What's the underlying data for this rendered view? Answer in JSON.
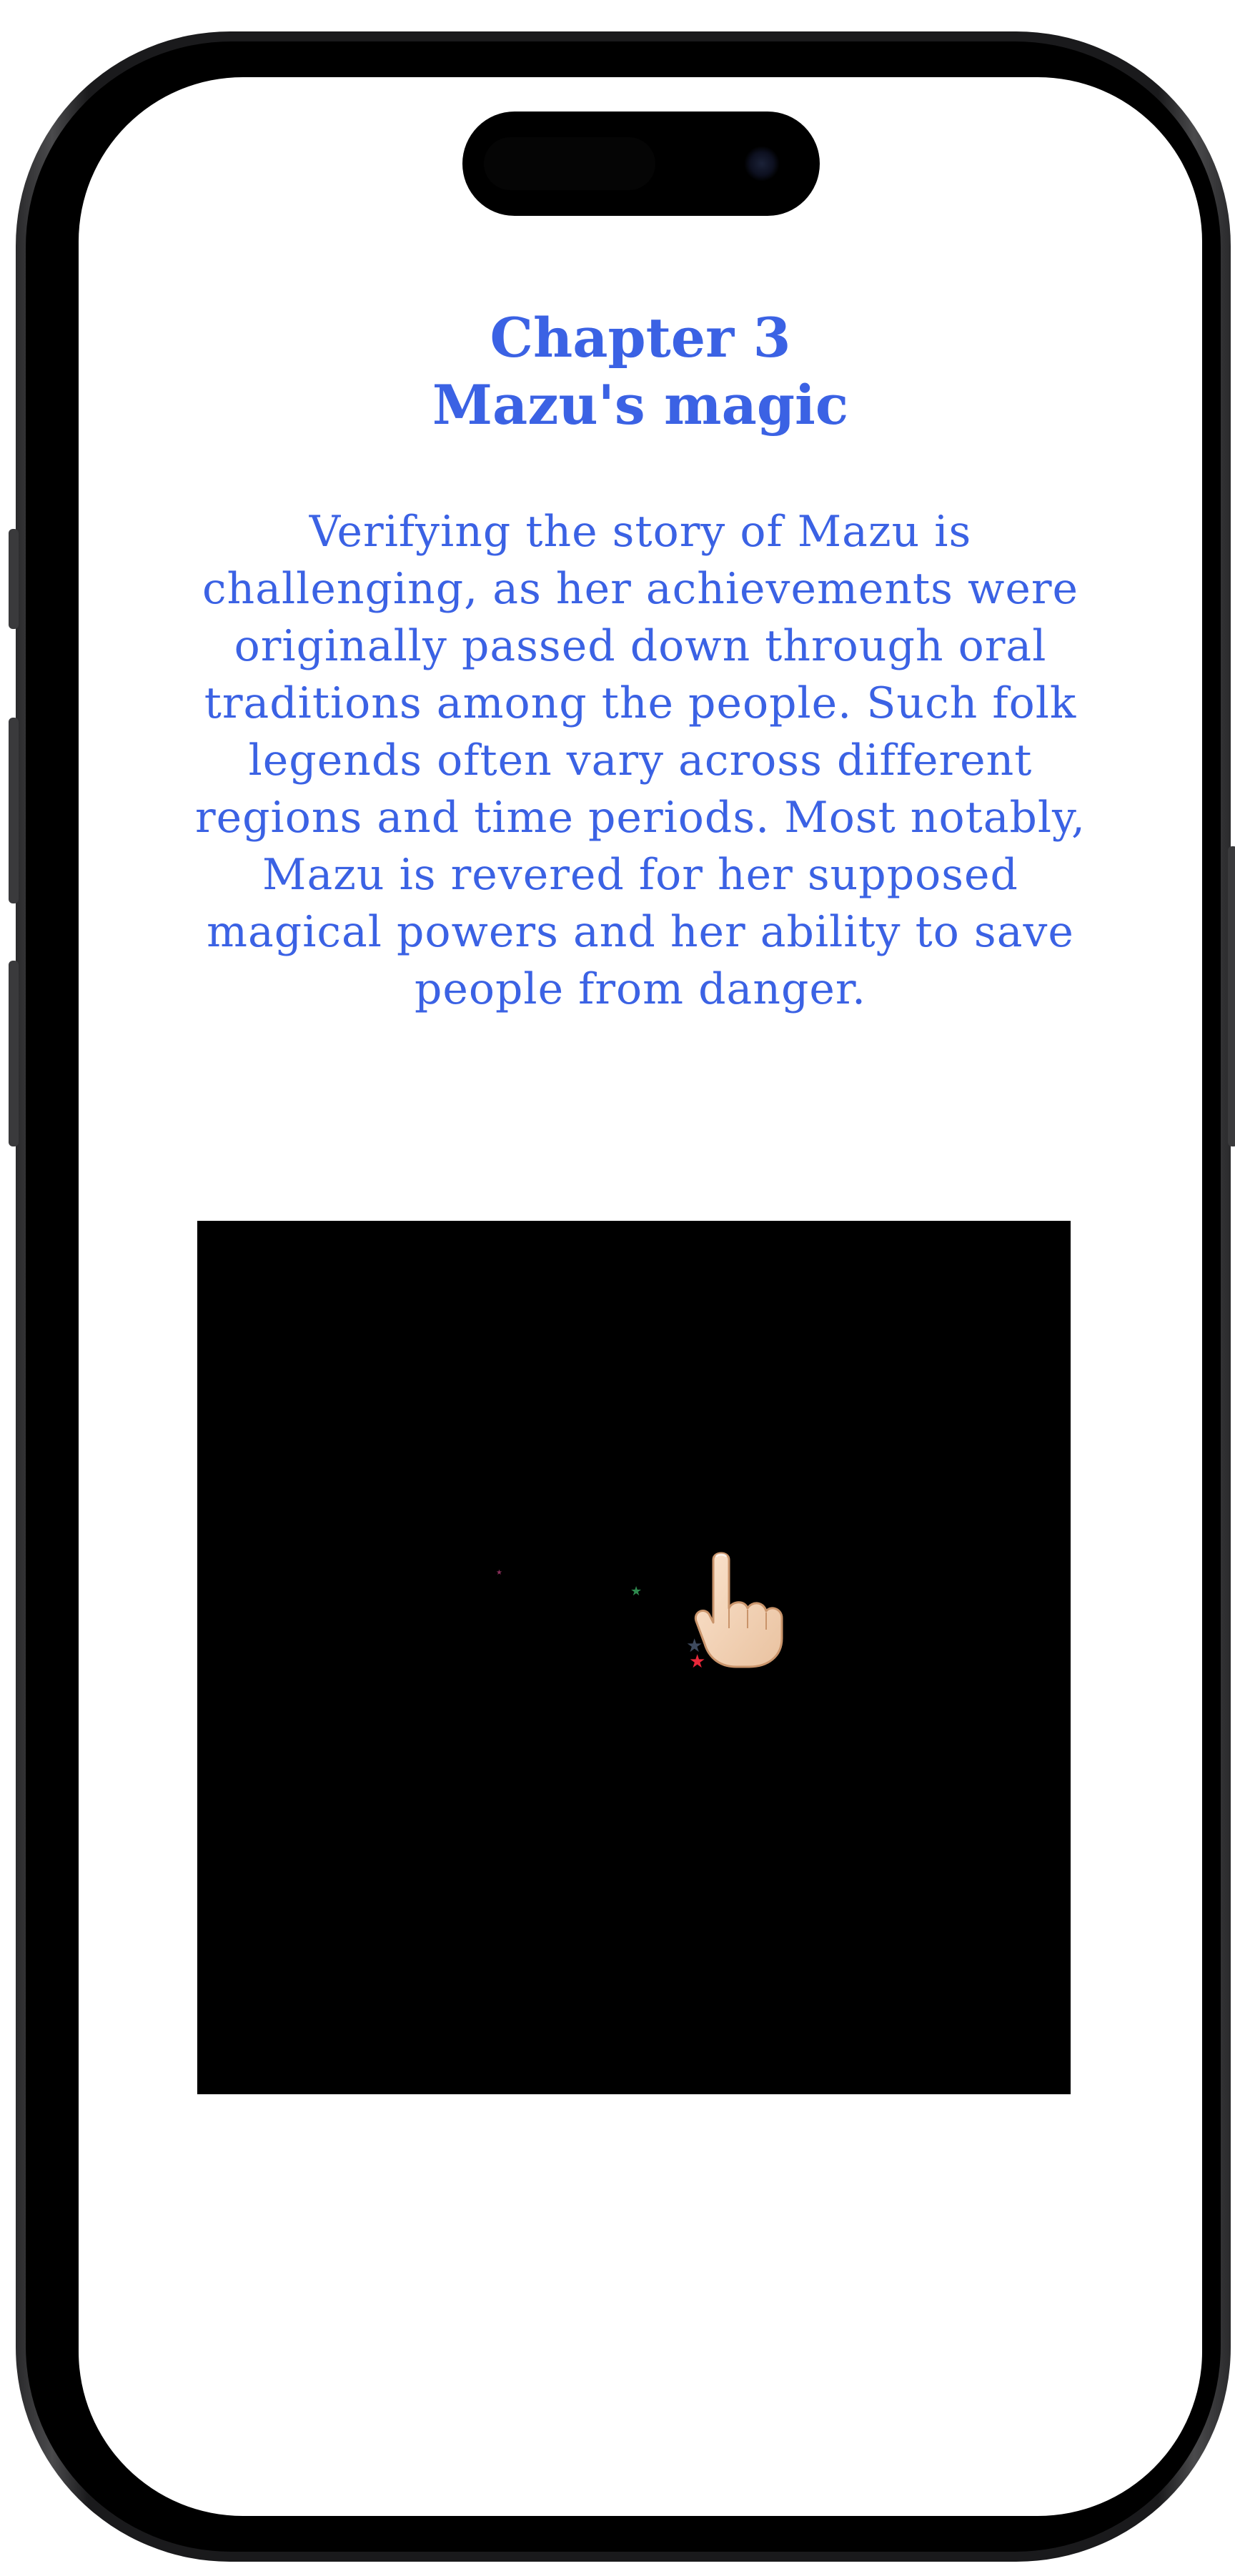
{
  "chapter": {
    "number_line": "Chapter 3",
    "title_line": "Mazu's magic"
  },
  "story": {
    "paragraph": "Verifying the story of Mazu is challenging, as her achievements were originally passed down through oral traditions among the people. Such folk legends often vary across different regions and time periods. Most notably, Mazu is revered for her supposed magical powers and her ability to save people from danger."
  },
  "canvas": {
    "background": "#000000",
    "pointer_icon": "pointing-hand-icon",
    "sparkles": [
      {
        "icon": "star-icon",
        "color": "#8a2f5a"
      },
      {
        "icon": "star-icon",
        "color": "#2e8a4e"
      },
      {
        "icon": "star-icon",
        "color": "#3e4a5e"
      },
      {
        "icon": "star-icon",
        "color": "#e8283a"
      }
    ]
  },
  "colors": {
    "text_accent": "#3b62e4",
    "screen_bg": "#ffffff"
  }
}
